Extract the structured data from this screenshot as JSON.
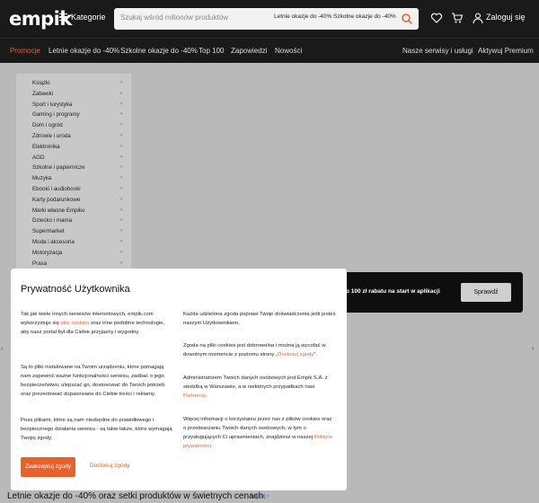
{
  "header": {
    "logo": "empik",
    "categories_label": "Kategorie",
    "search_placeholder": "Szukaj wśród milionów produktów",
    "chip1": "Letnie okazje do -40%",
    "chip2": "Szkolne okazje do -40%",
    "login_label": "Zaloguj się"
  },
  "nav": {
    "items": [
      "Promocje",
      "Letnie okazje do -40%",
      "Szkolne okazje do -40%",
      "Top 100",
      "Zapowiedzi",
      "Nowości"
    ],
    "right_items": [
      "Nasze serwisy i usługi",
      "Aktywuj Premium"
    ]
  },
  "sidebar": {
    "items": [
      {
        "label": "Książki"
      },
      {
        "label": "Zabawki"
      },
      {
        "label": "Sport i turystyka"
      },
      {
        "label": "Gaming i programy"
      },
      {
        "label": "Dom i ogród"
      },
      {
        "label": "Zdrowie i uroda"
      },
      {
        "label": "Elektronika"
      },
      {
        "label": "AGD"
      },
      {
        "label": "Szkolne i papiernicze"
      },
      {
        "label": "Muzyka"
      },
      {
        "label": "Ebooki i audiobooki"
      },
      {
        "label": "Karty podarunkowe"
      },
      {
        "label": "Marki własne Empiku"
      },
      {
        "label": "Dziecko i mama"
      },
      {
        "label": "Supermarket"
      },
      {
        "label": "Moda i akcesoria"
      },
      {
        "label": "Motoryzacja"
      },
      {
        "label": "Prasa"
      }
    ],
    "chevron": "›"
  },
  "banner": {
    "text": "o 100 zł rabatu na start w aplikacji",
    "button": "Sprawdź"
  },
  "edge_arrows": {
    "left": "‹",
    "right": "›"
  },
  "modal": {
    "title": "Prywatność Użytkownika",
    "left": {
      "p1_a": "Tak jak wiele innych serwisów internetowych, empik.com wykorzystuje się ",
      "p1_link": "pliki cookies",
      "p1_b": " oraz inne podobne technologie, aby nasz portal był dla Ciebie przyjazny i wygodny.",
      "p2": "Są to pliki instalowane na Twoim urządzeniu, które pomagają nam zapewnić ważne funkcjonalności serwisu, zadbać o jego bezpieczeństwo, ulepszać go, dostosować do Twoich potrzeb oraz prezentować dopasowane do Ciebie treści i reklamy.",
      "p3": "Poza plikami, które są nam niezbędne do prawidłowego i bezpiecznego działania serwisu - są takie także, które wymagają Twojej zgody."
    },
    "right": {
      "p1": "Każda udzielona zgoda poprawi Twoje doświadczenia jeśli jesteś naszym Użytkownikiem.",
      "p2_a": "Zgoda na pliki cookies jest dobrowolna i można ją wycofać w dowolnym momencie z poziomu strony „",
      "p2_link": "Dostosuj zgody",
      "p2_b": "”.",
      "p3_a": "Administratorem Twoich danych osobowych jest Empik S.A. z siedzibą w Warszawie, a w niektórych przypadkach nasi ",
      "p3_link": "Partnerzy",
      "p3_b": ".",
      "p4_a": "Więcej informacji o korzystaniu przez nas z plików cookies oraz o przetwarzaniu Twoich danych osobowych, w tym o przysługujących Ci uprawnieniach, znajdziesz w naszej ",
      "p4_link": "Polityce prywatności",
      "p4_b": "."
    },
    "accept_label": "Zaakceptuj zgody",
    "customize_label": "Dostosuj zgody"
  },
  "bottom": {
    "title": "Letnie okazje do -40% oraz setki produktów w świetnych cenach",
    "more": "więcej ›"
  },
  "colors": {
    "accent": "#e8602c",
    "header_bg": "#1a1a1a"
  }
}
